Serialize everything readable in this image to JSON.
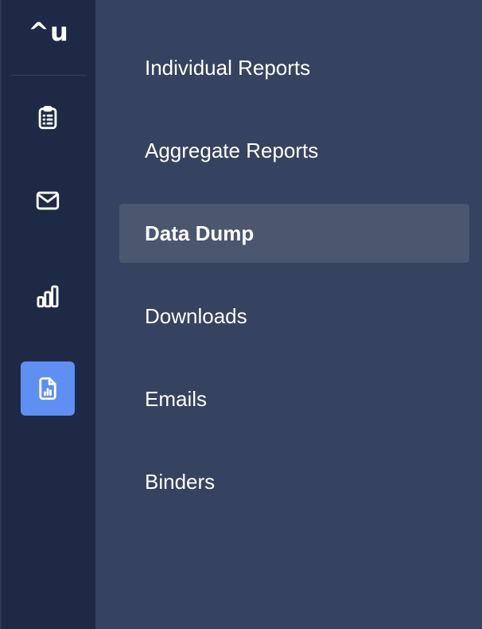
{
  "logo": {
    "text": "^u"
  },
  "rail": {
    "items": [
      {
        "icon": "clipboard-list-icon",
        "active": false
      },
      {
        "icon": "envelope-icon",
        "active": false
      },
      {
        "icon": "bar-chart-icon",
        "active": false
      },
      {
        "icon": "file-chart-icon",
        "active": true
      }
    ]
  },
  "menu": {
    "items": [
      {
        "label": "Individual Reports",
        "active": false
      },
      {
        "label": "Aggregate Reports",
        "active": false
      },
      {
        "label": "Data Dump",
        "active": true
      },
      {
        "label": "Downloads",
        "active": false
      },
      {
        "label": "Emails",
        "active": false
      },
      {
        "label": "Binders",
        "active": false
      }
    ]
  },
  "colors": {
    "rail_bg": "#1e2a45",
    "menu_bg": "#364360",
    "active_menu_bg": "#4b566f",
    "accent": "#5f8ff2",
    "text": "#ffffff"
  }
}
